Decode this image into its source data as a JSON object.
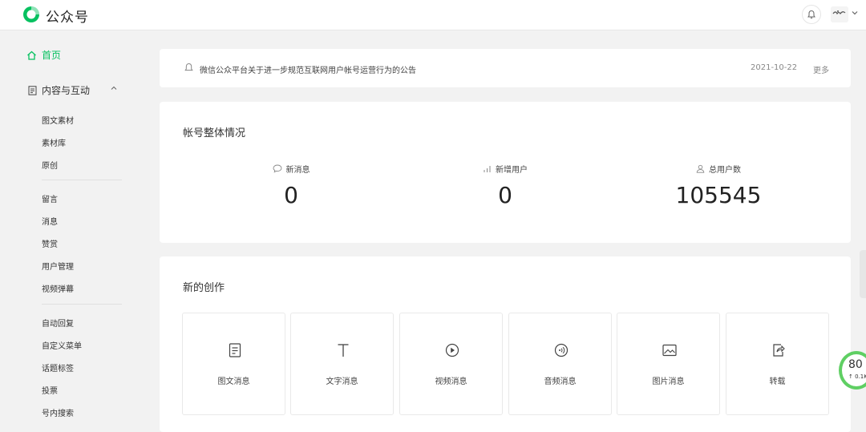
{
  "header": {
    "brand": "公众号",
    "colors": {
      "accent": "#07c160"
    },
    "icons": [
      "wechat-logo-icon",
      "bell-icon",
      "chevron-down-icon"
    ]
  },
  "sidebar": {
    "home": "首页",
    "section": "内容与互动",
    "group1": [
      "图文素材",
      "素材库",
      "原创"
    ],
    "group2": [
      "留言",
      "消息",
      "赞赏",
      "用户管理",
      "视频弹幕"
    ],
    "group3": [
      "自动回复",
      "自定义菜单",
      "话题标签",
      "投票",
      "号内搜索"
    ]
  },
  "notice": {
    "text": "微信公众平台关于进一步规范互联网用户帐号运营行为的公告",
    "date": "2021-10-22",
    "more": "更多"
  },
  "overview": {
    "title": "帐号整体情况",
    "stats": [
      {
        "label": "新消息",
        "value": "0",
        "icon": "message-bubble-icon"
      },
      {
        "label": "新增用户",
        "value": "0",
        "icon": "bar-chart-icon"
      },
      {
        "label": "总用户数",
        "value": "105545",
        "icon": "user-icon"
      }
    ]
  },
  "create": {
    "title": "新的创作",
    "tiles": [
      {
        "label": "图文消息",
        "icon": "document-icon"
      },
      {
        "label": "文字消息",
        "icon": "text-icon"
      },
      {
        "label": "视频消息",
        "icon": "play-icon"
      },
      {
        "label": "音频消息",
        "icon": "audio-icon"
      },
      {
        "label": "图片消息",
        "icon": "image-icon"
      },
      {
        "label": "转载",
        "icon": "share-icon"
      }
    ]
  },
  "widget": {
    "percent": "80",
    "rate": "↑ 0.1K/s"
  }
}
